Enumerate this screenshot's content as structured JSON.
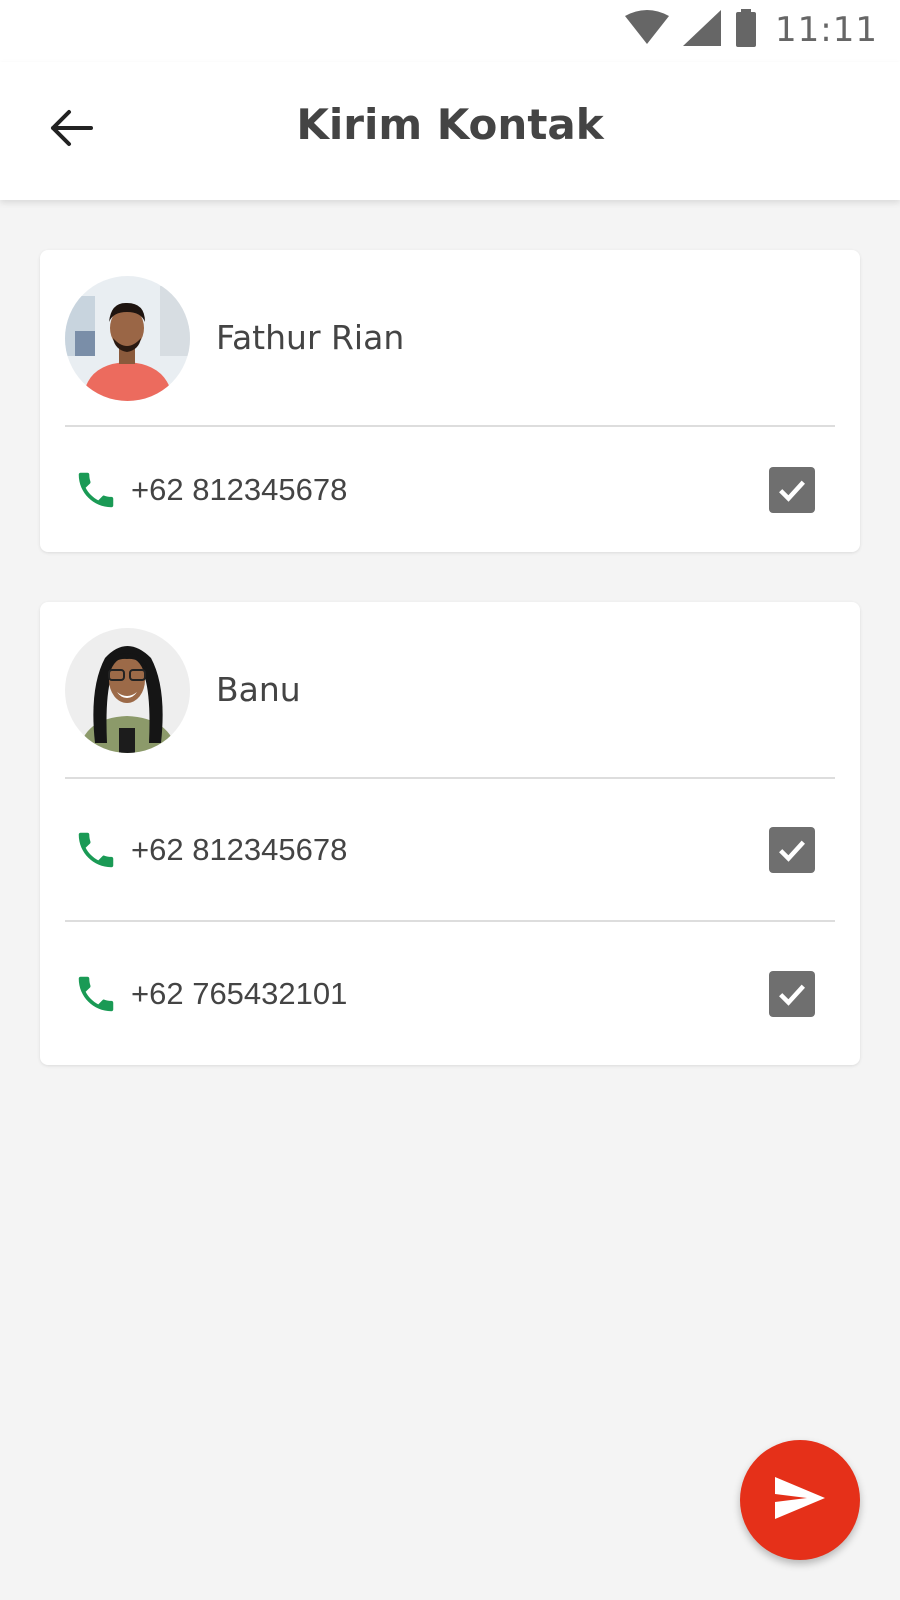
{
  "status_bar": {
    "time": "11:11",
    "icons": [
      "wifi-icon",
      "signal-icon",
      "battery-icon"
    ]
  },
  "app_bar": {
    "title": "Kirim Kontak",
    "back_icon": "arrow-left-icon"
  },
  "contacts": [
    {
      "name": "Fathur Rian",
      "avatar": "avatar-photo",
      "phones": [
        {
          "number": "+62 812345678",
          "checked": true
        }
      ]
    },
    {
      "name": "Banu",
      "avatar": "avatar-photo",
      "phones": [
        {
          "number": "+62 812345678",
          "checked": true
        },
        {
          "number": "+62 765432101",
          "checked": true
        }
      ]
    }
  ],
  "fab": {
    "icon": "send-icon"
  },
  "colors": {
    "accent": "#e53019",
    "phone_icon": "#1a9a55",
    "checkbox": "#6f6f6f",
    "background": "#f4f4f4"
  }
}
